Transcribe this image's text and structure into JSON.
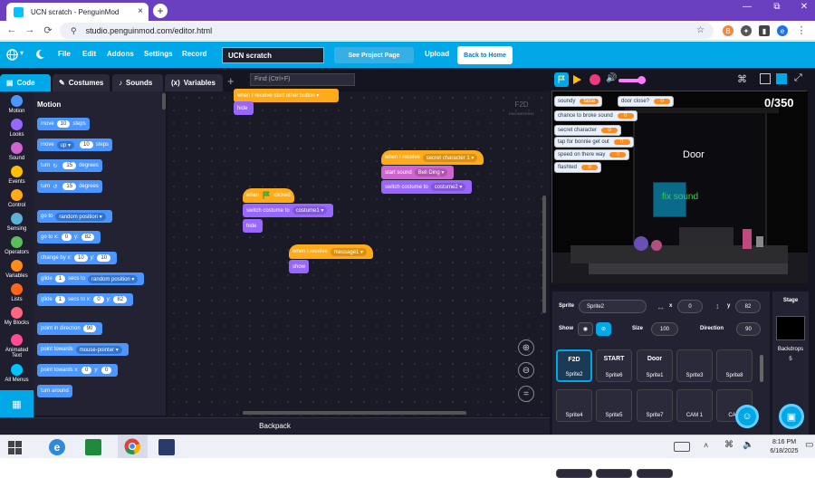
{
  "browser": {
    "tab_title": "UCN scratch - PenguinMod",
    "close_glyph": "×",
    "new_tab_glyph": "+",
    "url": "studio.penguinmod.com/editor.html",
    "win_min": "—",
    "win_restore": "⧉",
    "win_close": "✕",
    "back": "←",
    "forward": "→",
    "reload": "⟳",
    "lock": "⚲",
    "star": "☆",
    "profile_letter": "e",
    "menu_dots": "⋮"
  },
  "menubar": {
    "file": "File",
    "edit": "Edit",
    "addons": "Addons",
    "settings": "Settings",
    "record": "Record",
    "project_title": "UCN scratch",
    "see_project": "See Project Page",
    "upload": "Upload",
    "back_home": "Back to Home",
    "globe_icon": "globe-icon"
  },
  "editor_tabs": {
    "code": "Code",
    "costumes": "Costumes",
    "sounds": "Sounds",
    "variables": "Variables",
    "add": "+",
    "find_placeholder": "Find (Ctrl+F)"
  },
  "categories": [
    {
      "label": "Motion",
      "color": "#4c97ff"
    },
    {
      "label": "Looks",
      "color": "#9966ff"
    },
    {
      "label": "Sound",
      "color": "#cf63cf"
    },
    {
      "label": "Events",
      "color": "#ffbf00"
    },
    {
      "label": "Control",
      "color": "#ffab19"
    },
    {
      "label": "Sensing",
      "color": "#5cb1d6"
    },
    {
      "label": "Operators",
      "color": "#59c059"
    },
    {
      "label": "Variables",
      "color": "#ff8c1a"
    },
    {
      "label": "Lists",
      "color": "#ff661a"
    },
    {
      "label": "My Blocks",
      "color": "#ff6680"
    },
    {
      "label": "Animated Text",
      "color": "#ff4d94"
    },
    {
      "label": "All Menus",
      "color": "#00c3ff"
    }
  ],
  "palette": {
    "heading": "Motion",
    "move_steps": [
      "move",
      "10",
      "steps"
    ],
    "move_up": [
      "move",
      "up ▾",
      "10",
      "steps"
    ],
    "turn_right": [
      "turn",
      "↻",
      "15",
      "degrees"
    ],
    "turn_left": [
      "turn",
      "↺",
      "15",
      "degrees"
    ],
    "go_to": [
      "go to",
      "random position ▾"
    ],
    "go_to_xy": [
      "go to x:",
      "0",
      "y:",
      "82"
    ],
    "change_by": [
      "change by x:",
      "10",
      "y:",
      "10"
    ],
    "glide_random": [
      "glide",
      "1",
      "secs to",
      "random position ▾"
    ],
    "glide_xy": [
      "glide",
      "1",
      "secs to x:",
      "0",
      "y:",
      "82"
    ],
    "point_dir": [
      "point in direction",
      "90"
    ],
    "point_towards": [
      "point towards",
      "mouse-pointer ▾"
    ],
    "point_towards_xy": [
      "point towards x:",
      "0",
      "y:",
      "0"
    ],
    "turn_around": "turn around"
  },
  "scripts": {
    "top_partial": "when I receive  start other button ▾",
    "top_hide": "hide",
    "receive_secret": [
      "when I receive",
      "secret character 1 ▾"
    ],
    "start_sound": [
      "start sound",
      "Bell Ding ▾"
    ],
    "switch_costume2": [
      "switch costume to",
      "costume2 ▾"
    ],
    "flag_clicked": [
      "when",
      "clicked"
    ],
    "switch_costume1": [
      "switch costume to",
      "costume1 ▾"
    ],
    "hide": "hide",
    "receive_message": [
      "when I receive",
      "message1 ▾"
    ],
    "show": "show"
  },
  "backpack": "Backpack",
  "stage_monitors": [
    {
      "label": "soundy",
      "value": "false"
    },
    {
      "label": "door close?",
      "value": "0"
    },
    {
      "label": "chance to broke sound",
      "value": "0"
    },
    {
      "label": "secret character",
      "value": "0"
    },
    {
      "label": "tap for bonnie get out",
      "value": "0"
    },
    {
      "label": "speed on there way",
      "value": "0"
    },
    {
      "label": "flashted",
      "value": "0"
    }
  ],
  "stage": {
    "counter": "0/350",
    "door_label": "Door",
    "fix_sound": "fix sound"
  },
  "sprite_info": {
    "sprite_label": "Sprite",
    "sprite_name": "Sprite2",
    "x_label": "x",
    "x": "0",
    "y_label": "y",
    "y": "82",
    "show_label": "Show",
    "size_label": "Size",
    "size": "100",
    "direction_label": "Direction",
    "direction": "90"
  },
  "sprites": [
    "Sprite2",
    "Sprite6",
    "Sprite1",
    "Sprite3",
    "Sprite8",
    "Sprite4",
    "Sprite5",
    "Sprite7",
    "CAM 1",
    "CAM"
  ],
  "sprite_thumbs": [
    "F2D",
    "START",
    "Door",
    "",
    "",
    "",
    "",
    "",
    "",
    ""
  ],
  "stage_panel": {
    "title": "Stage",
    "backdrops_label": "Backdrops",
    "backdrops": "5"
  },
  "taskbar": {
    "time": "8:16 PM",
    "date": "6/18/2025"
  },
  "colors": {
    "accent": "#00a8e8",
    "browser_frame": "#6a3fc0"
  }
}
